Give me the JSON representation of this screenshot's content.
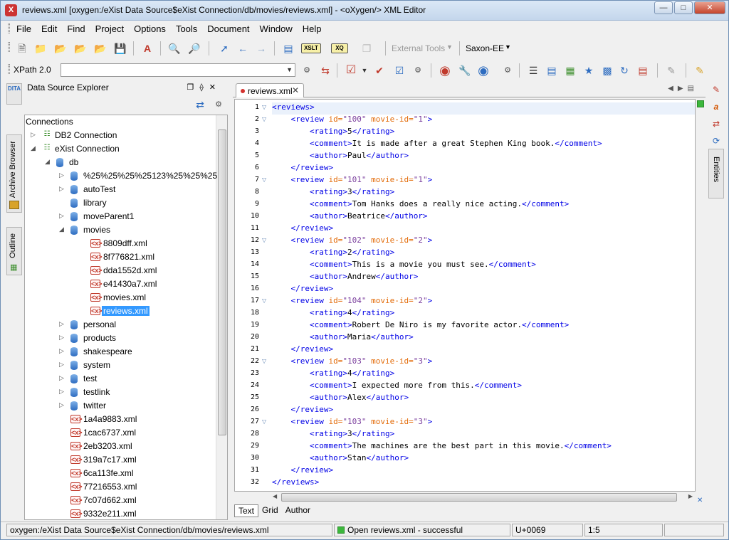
{
  "window": {
    "title": "reviews.xml [oxygen:/eXist Data Source$eXist Connection/db/movies/reviews.xml] - <oXygen/> XML Editor",
    "app_icon": "X"
  },
  "menu": [
    "File",
    "Edit",
    "Find",
    "Project",
    "Options",
    "Tools",
    "Document",
    "Window",
    "Help"
  ],
  "toolbar": {
    "external_tools_label": "External Tools",
    "transformer_label": "Saxon-EE",
    "xpath_version": "XPath 2.0",
    "xpath_value": "",
    "xslt_label": "XSLT",
    "xq_label": "XQ"
  },
  "left_tabs": {
    "dita_label": "DITA",
    "archive_browser": "Archive Browser",
    "outline": "Outline"
  },
  "explorer": {
    "title": "Data Source Explorer",
    "connections_label": "Connections",
    "tree": [
      {
        "label": "DB2 Connection",
        "kind": "conn",
        "level": 0,
        "twisty": "closed"
      },
      {
        "label": "eXist Connection",
        "kind": "conn",
        "level": 0,
        "twisty": "open"
      },
      {
        "label": "db",
        "kind": "db",
        "level": 1,
        "twisty": "open"
      },
      {
        "label": "%25%25%25%25123%25%25%25",
        "kind": "db",
        "level": 2,
        "twisty": "closed"
      },
      {
        "label": "autoTest",
        "kind": "db",
        "level": 2,
        "twisty": "closed"
      },
      {
        "label": "library",
        "kind": "db",
        "level": 2,
        "twisty": "none"
      },
      {
        "label": "moveParent1",
        "kind": "db",
        "level": 2,
        "twisty": "closed"
      },
      {
        "label": "movies",
        "kind": "db",
        "level": 2,
        "twisty": "open"
      },
      {
        "label": "8809dff.xml",
        "kind": "xml",
        "level": 3,
        "twisty": "none"
      },
      {
        "label": "8f776821.xml",
        "kind": "xml",
        "level": 3,
        "twisty": "none"
      },
      {
        "label": "dda1552d.xml",
        "kind": "xml",
        "level": 3,
        "twisty": "none"
      },
      {
        "label": "e41430a7.xml",
        "kind": "xml",
        "level": 3,
        "twisty": "none"
      },
      {
        "label": "movies.xml",
        "kind": "xml",
        "level": 3,
        "twisty": "none"
      },
      {
        "label": "reviews.xml",
        "kind": "xml",
        "level": 3,
        "twisty": "none",
        "selected": true
      },
      {
        "label": "personal",
        "kind": "db",
        "level": 2,
        "twisty": "closed"
      },
      {
        "label": "products",
        "kind": "db",
        "level": 2,
        "twisty": "closed"
      },
      {
        "label": "shakespeare",
        "kind": "db",
        "level": 2,
        "twisty": "closed"
      },
      {
        "label": "system",
        "kind": "db",
        "level": 2,
        "twisty": "closed"
      },
      {
        "label": "test",
        "kind": "db",
        "level": 2,
        "twisty": "closed"
      },
      {
        "label": "testlink",
        "kind": "db",
        "level": 2,
        "twisty": "closed"
      },
      {
        "label": "twitter",
        "kind": "db",
        "level": 2,
        "twisty": "closed"
      },
      {
        "label": "1a4a9883.xml",
        "kind": "xml",
        "level": 2,
        "twisty": "none"
      },
      {
        "label": "1cac6737.xml",
        "kind": "xml",
        "level": 2,
        "twisty": "none"
      },
      {
        "label": "2eb3203.xml",
        "kind": "xml",
        "level": 2,
        "twisty": "none"
      },
      {
        "label": "319a7c17.xml",
        "kind": "xml",
        "level": 2,
        "twisty": "none"
      },
      {
        "label": "6ca113fe.xml",
        "kind": "xml",
        "level": 2,
        "twisty": "none"
      },
      {
        "label": "77216553.xml",
        "kind": "xml",
        "level": 2,
        "twisty": "none"
      },
      {
        "label": "7c07d662.xml",
        "kind": "xml",
        "level": 2,
        "twisty": "none"
      },
      {
        "label": "9332e211.xml",
        "kind": "xml",
        "level": 2,
        "twisty": "none"
      }
    ]
  },
  "editor": {
    "tab_label": "reviews.xml",
    "mode_tabs": [
      "Text",
      "Grid",
      "Author"
    ],
    "active_mode": "Text",
    "lines": [
      [
        [
          "tag",
          "<reviews>"
        ]
      ],
      [
        [
          "ind",
          "    "
        ],
        [
          "tag",
          "<review "
        ],
        [
          "attr",
          "id="
        ],
        [
          "val",
          "\"100\""
        ],
        [
          "attr",
          " movie-id="
        ],
        [
          "val",
          "\"1\""
        ],
        [
          "tag",
          ">"
        ]
      ],
      [
        [
          "ind",
          "        "
        ],
        [
          "tag",
          "<rating>"
        ],
        [
          "txt",
          "5"
        ],
        [
          "tag",
          "</rating>"
        ]
      ],
      [
        [
          "ind",
          "        "
        ],
        [
          "tag",
          "<comment>"
        ],
        [
          "txt",
          "It is made after a great Stephen King book."
        ],
        [
          "tag",
          "</comment>"
        ]
      ],
      [
        [
          "ind",
          "        "
        ],
        [
          "tag",
          "<author>"
        ],
        [
          "txt",
          "Paul"
        ],
        [
          "tag",
          "</author>"
        ]
      ],
      [
        [
          "ind",
          "    "
        ],
        [
          "tag",
          "</review>"
        ]
      ],
      [
        [
          "ind",
          "    "
        ],
        [
          "tag",
          "<review "
        ],
        [
          "attr",
          "id="
        ],
        [
          "val",
          "\"101\""
        ],
        [
          "attr",
          " movie-id="
        ],
        [
          "val",
          "\"1\""
        ],
        [
          "tag",
          ">"
        ]
      ],
      [
        [
          "ind",
          "        "
        ],
        [
          "tag",
          "<rating>"
        ],
        [
          "txt",
          "3"
        ],
        [
          "tag",
          "</rating>"
        ]
      ],
      [
        [
          "ind",
          "        "
        ],
        [
          "tag",
          "<comment>"
        ],
        [
          "txt",
          "Tom Hanks does a really nice acting."
        ],
        [
          "tag",
          "</comment>"
        ]
      ],
      [
        [
          "ind",
          "        "
        ],
        [
          "tag",
          "<author>"
        ],
        [
          "txt",
          "Beatrice"
        ],
        [
          "tag",
          "</author>"
        ]
      ],
      [
        [
          "ind",
          "    "
        ],
        [
          "tag",
          "</review>"
        ]
      ],
      [
        [
          "ind",
          "    "
        ],
        [
          "tag",
          "<review "
        ],
        [
          "attr",
          "id="
        ],
        [
          "val",
          "\"102\""
        ],
        [
          "attr",
          " movie-id="
        ],
        [
          "val",
          "\"2\""
        ],
        [
          "tag",
          ">"
        ]
      ],
      [
        [
          "ind",
          "        "
        ],
        [
          "tag",
          "<rating>"
        ],
        [
          "txt",
          "2"
        ],
        [
          "tag",
          "</rating>"
        ]
      ],
      [
        [
          "ind",
          "        "
        ],
        [
          "tag",
          "<comment>"
        ],
        [
          "txt",
          "This is a movie you must see."
        ],
        [
          "tag",
          "</comment>"
        ]
      ],
      [
        [
          "ind",
          "        "
        ],
        [
          "tag",
          "<author>"
        ],
        [
          "txt",
          "Andrew"
        ],
        [
          "tag",
          "</author>"
        ]
      ],
      [
        [
          "ind",
          "    "
        ],
        [
          "tag",
          "</review>"
        ]
      ],
      [
        [
          "ind",
          "    "
        ],
        [
          "tag",
          "<review "
        ],
        [
          "attr",
          "id="
        ],
        [
          "val",
          "\"104\""
        ],
        [
          "attr",
          " movie-id="
        ],
        [
          "val",
          "\"2\""
        ],
        [
          "tag",
          ">"
        ]
      ],
      [
        [
          "ind",
          "        "
        ],
        [
          "tag",
          "<rating>"
        ],
        [
          "txt",
          "4"
        ],
        [
          "tag",
          "</rating>"
        ]
      ],
      [
        [
          "ind",
          "        "
        ],
        [
          "tag",
          "<comment>"
        ],
        [
          "txt",
          "Robert De Niro is my favorite actor."
        ],
        [
          "tag",
          "</comment>"
        ]
      ],
      [
        [
          "ind",
          "        "
        ],
        [
          "tag",
          "<author>"
        ],
        [
          "txt",
          "Maria"
        ],
        [
          "tag",
          "</author>"
        ]
      ],
      [
        [
          "ind",
          "    "
        ],
        [
          "tag",
          "</review>"
        ]
      ],
      [
        [
          "ind",
          "    "
        ],
        [
          "tag",
          "<review "
        ],
        [
          "attr",
          "id="
        ],
        [
          "val",
          "\"103\""
        ],
        [
          "attr",
          " movie-id="
        ],
        [
          "val",
          "\"3\""
        ],
        [
          "tag",
          ">"
        ]
      ],
      [
        [
          "ind",
          "        "
        ],
        [
          "tag",
          "<rating>"
        ],
        [
          "txt",
          "4"
        ],
        [
          "tag",
          "</rating>"
        ]
      ],
      [
        [
          "ind",
          "        "
        ],
        [
          "tag",
          "<comment>"
        ],
        [
          "txt",
          "I expected more from this."
        ],
        [
          "tag",
          "</comment>"
        ]
      ],
      [
        [
          "ind",
          "        "
        ],
        [
          "tag",
          "<author>"
        ],
        [
          "txt",
          "Alex"
        ],
        [
          "tag",
          "</author>"
        ]
      ],
      [
        [
          "ind",
          "    "
        ],
        [
          "tag",
          "</review>"
        ]
      ],
      [
        [
          "ind",
          "    "
        ],
        [
          "tag",
          "<review "
        ],
        [
          "attr",
          "id="
        ],
        [
          "val",
          "\"103\""
        ],
        [
          "attr",
          " movie-id="
        ],
        [
          "val",
          "\"3\""
        ],
        [
          "tag",
          ">"
        ]
      ],
      [
        [
          "ind",
          "        "
        ],
        [
          "tag",
          "<rating>"
        ],
        [
          "txt",
          "3"
        ],
        [
          "tag",
          "</rating>"
        ]
      ],
      [
        [
          "ind",
          "        "
        ],
        [
          "tag",
          "<comment>"
        ],
        [
          "txt",
          "The machines are the best part in this movie."
        ],
        [
          "tag",
          "</comment>"
        ]
      ],
      [
        [
          "ind",
          "        "
        ],
        [
          "tag",
          "<author>"
        ],
        [
          "txt",
          "Stan"
        ],
        [
          "tag",
          "</author>"
        ]
      ],
      [
        [
          "ind",
          "    "
        ],
        [
          "tag",
          "</review>"
        ]
      ],
      [
        [
          "tag",
          "</reviews>"
        ]
      ]
    ],
    "fold_lines": [
      1,
      2,
      7,
      12,
      17,
      22,
      27
    ]
  },
  "right_tabs": {
    "entities": "Entities"
  },
  "status": {
    "path": "oxygen:/eXist Data Source$eXist Connection/db/movies/reviews.xml",
    "message": "Open reviews.xml - successful",
    "unicode": "U+0069",
    "position": "1:5"
  }
}
